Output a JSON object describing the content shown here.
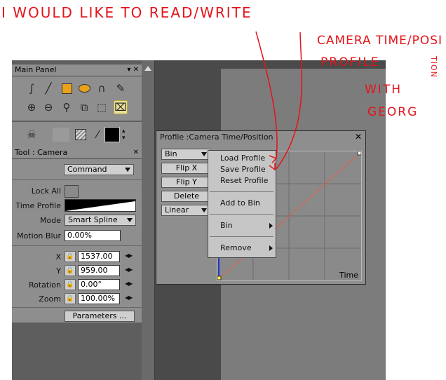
{
  "annotations": {
    "line1": "I   WOULD   LIKE  TO   READ/WRITE",
    "camera": "CAMERA TIME/POSI",
    "tion": "TION",
    "profile": "PROFILE",
    "with": "WITH",
    "georg": "GEORG"
  },
  "main_panel": {
    "title": "Main Panel",
    "tools_row1": [
      "spline-draw-icon",
      "line-icon",
      "rectangle-icon",
      "ellipse-icon",
      "bezier-icon",
      "brush-icon"
    ],
    "tools_row2": [
      "zoom-region-icon",
      "zoom-out-icon",
      "magnify-icon",
      "crop-icon",
      "select-crop-icon",
      "camera-icon"
    ]
  },
  "tool_panel": {
    "title": "Tool : Camera",
    "command": "Command",
    "lock_all": "Lock All",
    "time_profile": "Time Profile",
    "mode_label": "Mode",
    "mode_value": "Smart Spline",
    "motion_blur_label": "Motion Blur",
    "motion_blur_value": "0.00%",
    "x_label": "X",
    "x_value": "1537.00",
    "y_label": "Y",
    "y_value": "959.00",
    "rotation_label": "Rotation",
    "rotation_value": "0.00°",
    "zoom_label": "Zoom",
    "zoom_value": "100.00%",
    "parameters": "Parameters ..."
  },
  "profile_dialog": {
    "title": "Profile :Camera Time/Position",
    "bin": "Bin",
    "flip_x": "Flip X",
    "flip_y": "Flip Y",
    "delete": "Delete",
    "interp": "Linear",
    "graph_axis": "Time",
    "graph_line_color": "#e0604a"
  },
  "context_menu": {
    "load": "Load Profile",
    "save": "Save Profile",
    "reset": "Reset Profile",
    "add_to_bin": "Add to Bin",
    "bin": "Bin",
    "remove": "Remove"
  },
  "colors": {
    "annotation": "#e4141b",
    "highlight": "#e7df9a"
  }
}
